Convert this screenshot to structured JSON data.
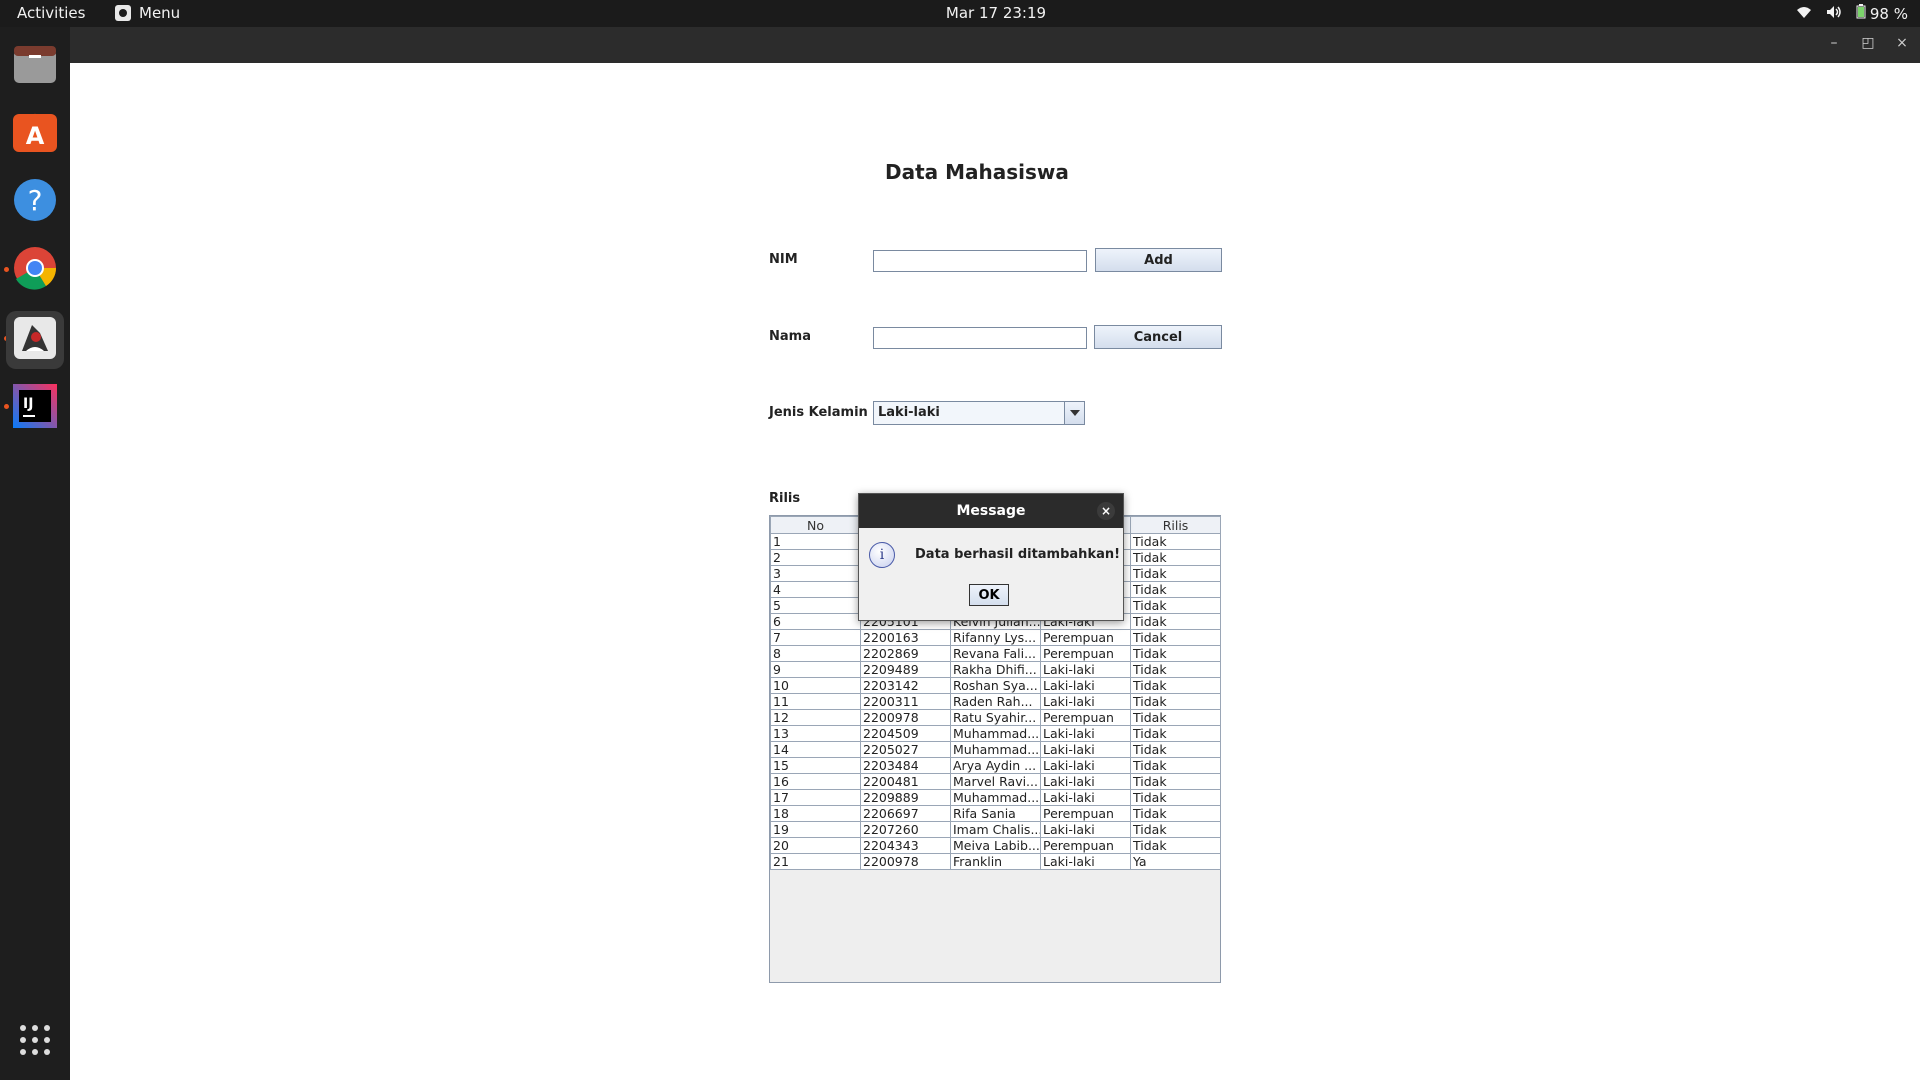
{
  "topbar": {
    "activities": "Activities",
    "menu": "Menu",
    "clock": "Mar 17  23:19",
    "battery": "98 %"
  },
  "dock": {
    "items": [
      "files-icon",
      "app-center-icon",
      "help-icon",
      "chrome-icon",
      "java-app-icon",
      "intellij-icon"
    ],
    "apps_grid": "show-apps-icon"
  },
  "form": {
    "heading": "Data Mahasiswa",
    "nim_label": "NIM",
    "nama_label": "Nama",
    "jenis_kelamin_label": "Jenis Kelamin",
    "rilis_label": "Rilis",
    "nim_value": "",
    "nama_value": "",
    "jenis_kelamin_value": "Laki-laki",
    "add_button": "Add",
    "cancel_button": "Cancel"
  },
  "table": {
    "columns": [
      "No",
      "",
      "",
      "",
      "Rilis"
    ],
    "rows": [
      [
        "1",
        "",
        "",
        "",
        "Tidak"
      ],
      [
        "2",
        "",
        "",
        "",
        "Tidak"
      ],
      [
        "3",
        "",
        "",
        "",
        "Tidak"
      ],
      [
        "4",
        "",
        "",
        "",
        "Tidak"
      ],
      [
        "5",
        "",
        "",
        "",
        "Tidak"
      ],
      [
        "6",
        "2205101",
        "Kelvin Julian...",
        "Laki-laki",
        "Tidak"
      ],
      [
        "7",
        "2200163",
        "Rifanny Lys...",
        "Perempuan",
        "Tidak"
      ],
      [
        "8",
        "2202869",
        "Revana Fali...",
        "Perempuan",
        "Tidak"
      ],
      [
        "9",
        "2209489",
        "Rakha Dhifi...",
        "Laki-laki",
        "Tidak"
      ],
      [
        "10",
        "2203142",
        "Roshan Sya...",
        "Laki-laki",
        "Tidak"
      ],
      [
        "11",
        "2200311",
        "Raden Rah...",
        "Laki-laki",
        "Tidak"
      ],
      [
        "12",
        "2200978",
        "Ratu Syahir...",
        "Perempuan",
        "Tidak"
      ],
      [
        "13",
        "2204509",
        "Muhammad...",
        "Laki-laki",
        "Tidak"
      ],
      [
        "14",
        "2205027",
        "Muhammad...",
        "Laki-laki",
        "Tidak"
      ],
      [
        "15",
        "2203484",
        "Arya Aydin ...",
        "Laki-laki",
        "Tidak"
      ],
      [
        "16",
        "2200481",
        "Marvel Ravi...",
        "Laki-laki",
        "Tidak"
      ],
      [
        "17",
        "2209889",
        "Muhammad...",
        "Laki-laki",
        "Tidak"
      ],
      [
        "18",
        "2206697",
        "Rifa Sania",
        "Perempuan",
        "Tidak"
      ],
      [
        "19",
        "2207260",
        "Imam Chalis...",
        "Laki-laki",
        "Tidak"
      ],
      [
        "20",
        "2204343",
        "Meiva Labib...",
        "Perempuan",
        "Tidak"
      ],
      [
        "21",
        "2200978",
        "Franklin",
        "Laki-laki",
        "Ya"
      ]
    ]
  },
  "dialog": {
    "title": "Message",
    "message": "Data berhasil ditambahkan!",
    "ok": "OK",
    "close": "×",
    "icon": "i"
  }
}
